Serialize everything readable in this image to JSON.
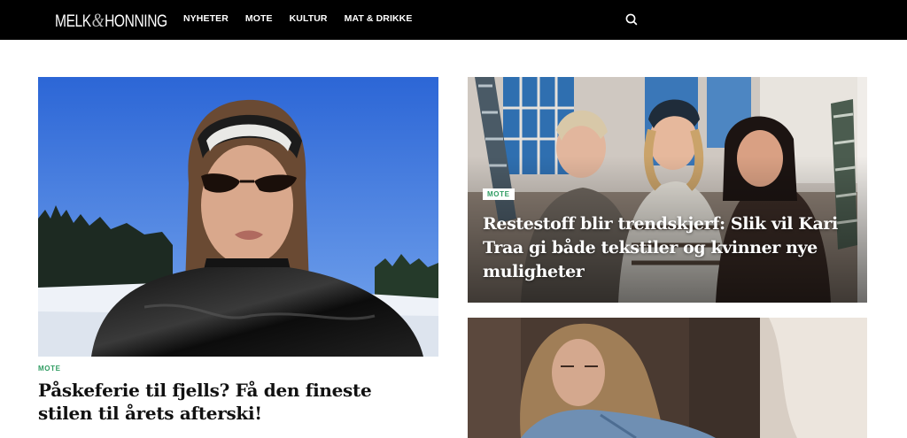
{
  "site": {
    "logo_left": "MELK",
    "logo_amp": "&",
    "logo_right": "HONNING"
  },
  "nav": {
    "items": [
      "NYHETER",
      "MOTE",
      "KULTUR",
      "MAT & DRIKKE"
    ]
  },
  "search": {
    "icon": "search-icon"
  },
  "articles": [
    {
      "category": "MOTE",
      "title": "Påskeferie til fjells? Få den fineste stilen til årets afterski!"
    },
    {
      "category": "MOTE",
      "title": "Restestoff blir trendskjerf: Slik vil Kari Traa gi både tekstiler og kvinner nye muligheter"
    },
    {
      "category": "",
      "title": ""
    }
  ],
  "colors": {
    "topbar": "#000000",
    "tag": "#2f9c62",
    "background": "#ffffff"
  }
}
